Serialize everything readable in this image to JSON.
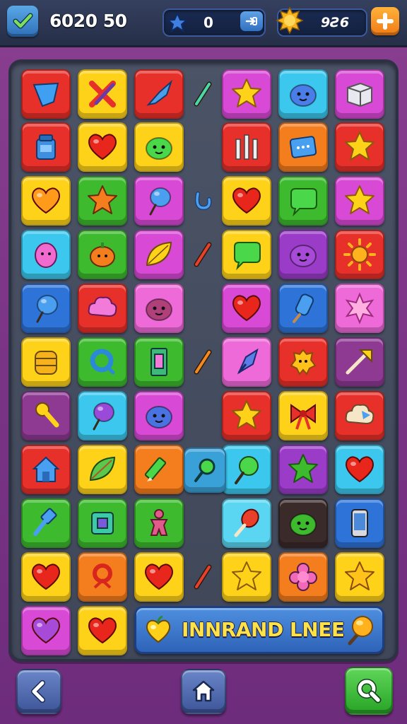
{
  "header": {
    "score": "6020 50",
    "stars_value": "0",
    "coins_value": "9Ƨ6"
  },
  "banner": {
    "text": "INNRAND LNEE"
  },
  "colors": {
    "red": "#e8302a",
    "yellow": "#ffd21a",
    "magenta": "#d84ad6",
    "cyan": "#3cc8ee",
    "orange": "#f47d1e",
    "green": "#3dba2e",
    "blue": "#2d73d8",
    "purple": "#9a3cc8",
    "pink": "#ee6ad8",
    "dark": "#3b2a2a",
    "plum": "#8e3a92",
    "lightcyan": "#5ad6f2"
  },
  "tiles": [
    {
      "r": 0,
      "c": 0,
      "color": "red",
      "icon": "blue-shield"
    },
    {
      "r": 0,
      "c": 1,
      "color": "yellow",
      "icon": "red-cross-pencil"
    },
    {
      "r": 0,
      "c": 2,
      "color": "red",
      "icon": "blue-rocket"
    },
    {
      "r": 0,
      "c": 3,
      "color": "magenta",
      "icon": "star"
    },
    {
      "r": 0,
      "c": 4,
      "color": "cyan",
      "icon": "blue-blob"
    },
    {
      "r": 0,
      "c": 5,
      "color": "magenta",
      "icon": "white-box"
    },
    {
      "r": 1,
      "c": 0,
      "color": "red",
      "icon": "blue-jar"
    },
    {
      "r": 1,
      "c": 1,
      "color": "yellow",
      "icon": "heart"
    },
    {
      "r": 1,
      "c": 2,
      "color": "yellow",
      "icon": "green-blob"
    },
    {
      "r": 1,
      "c": 3,
      "color": "red",
      "icon": "white-bars"
    },
    {
      "r": 1,
      "c": 4,
      "color": "orange",
      "icon": "blue-card"
    },
    {
      "r": 1,
      "c": 5,
      "color": "red",
      "icon": "star"
    },
    {
      "r": 2,
      "c": 0,
      "color": "yellow",
      "icon": "orange-heart"
    },
    {
      "r": 2,
      "c": 1,
      "color": "green",
      "icon": "orange-star"
    },
    {
      "r": 2,
      "c": 2,
      "color": "magenta",
      "icon": "blue-balloon"
    },
    {
      "r": 2,
      "c": 3,
      "color": "yellow",
      "icon": "heart"
    },
    {
      "r": 2,
      "c": 4,
      "color": "green",
      "icon": "green-bubble"
    },
    {
      "r": 2,
      "c": 5,
      "color": "magenta",
      "icon": "star"
    },
    {
      "r": 3,
      "c": 0,
      "color": "cyan",
      "icon": "pink-egg"
    },
    {
      "r": 3,
      "c": 1,
      "color": "green",
      "icon": "orange-pumpkin"
    },
    {
      "r": 3,
      "c": 2,
      "color": "magenta",
      "icon": "yellow-leaf"
    },
    {
      "r": 3,
      "c": 3,
      "color": "yellow",
      "icon": "green-bubble"
    },
    {
      "r": 3,
      "c": 4,
      "color": "purple",
      "icon": "purple-blob"
    },
    {
      "r": 3,
      "c": 5,
      "color": "red",
      "icon": "sun"
    },
    {
      "r": 4,
      "c": 0,
      "color": "blue",
      "icon": "blue-balloon"
    },
    {
      "r": 4,
      "c": 1,
      "color": "red",
      "icon": "pink-cloud"
    },
    {
      "r": 4,
      "c": 2,
      "color": "pink",
      "icon": "plum-blob"
    },
    {
      "r": 4,
      "c": 3,
      "color": "magenta",
      "icon": "heart"
    },
    {
      "r": 4,
      "c": 4,
      "color": "blue",
      "icon": "blue-popsicle"
    },
    {
      "r": 4,
      "c": 5,
      "color": "pink",
      "icon": "pink-burst"
    },
    {
      "r": 5,
      "c": 0,
      "color": "yellow",
      "icon": "yellow-pot"
    },
    {
      "r": 5,
      "c": 1,
      "color": "green",
      "icon": "blue-ring"
    },
    {
      "r": 5,
      "c": 2,
      "color": "green",
      "icon": "blue-door"
    },
    {
      "r": 5,
      "c": 3,
      "color": "pink",
      "icon": "blue-crystal"
    },
    {
      "r": 5,
      "c": 4,
      "color": "red",
      "icon": "yellow-monster"
    },
    {
      "r": 5,
      "c": 5,
      "color": "plum",
      "icon": "arrow"
    },
    {
      "r": 6,
      "c": 0,
      "color": "plum",
      "icon": "yellow-key"
    },
    {
      "r": 6,
      "c": 1,
      "color": "cyan",
      "icon": "purple-balloon"
    },
    {
      "r": 6,
      "c": 2,
      "color": "magenta",
      "icon": "blue-cat"
    },
    {
      "r": 6,
      "c": 3,
      "color": "red",
      "icon": "star"
    },
    {
      "r": 6,
      "c": 4,
      "color": "yellow",
      "icon": "red-bow"
    },
    {
      "r": 6,
      "c": 5,
      "color": "red",
      "icon": "cream-cloud"
    },
    {
      "r": 7,
      "c": 0,
      "color": "red",
      "icon": "blue-house"
    },
    {
      "r": 7,
      "c": 1,
      "color": "yellow",
      "icon": "green-leaf"
    },
    {
      "r": 7,
      "c": 2,
      "color": "orange",
      "icon": "green-pencil"
    },
    {
      "r": 7,
      "c": 3,
      "color": "cyan",
      "icon": "green-lollipop"
    },
    {
      "r": 7,
      "c": 4,
      "color": "purple",
      "icon": "green-star"
    },
    {
      "r": 7,
      "c": 5,
      "color": "cyan",
      "icon": "heart"
    },
    {
      "r": 8,
      "c": 0,
      "color": "green",
      "icon": "blue-hammer"
    },
    {
      "r": 8,
      "c": 1,
      "color": "green",
      "icon": "blue-square"
    },
    {
      "r": 8,
      "c": 2,
      "color": "green",
      "icon": "pink-gingerbread"
    },
    {
      "r": 8,
      "c": 3,
      "color": "lightcyan",
      "icon": "red-drumstick"
    },
    {
      "r": 8,
      "c": 4,
      "color": "dark",
      "icon": "green-smiley"
    },
    {
      "r": 8,
      "c": 5,
      "color": "blue",
      "icon": "phone"
    },
    {
      "r": 9,
      "c": 0,
      "color": "yellow",
      "icon": "heart"
    },
    {
      "r": 9,
      "c": 1,
      "color": "orange",
      "icon": "red-ring"
    },
    {
      "r": 9,
      "c": 2,
      "color": "yellow",
      "icon": "heart"
    },
    {
      "r": 9,
      "c": 3,
      "color": "yellow",
      "icon": "star"
    },
    {
      "r": 9,
      "c": 4,
      "color": "orange",
      "icon": "pink-flower"
    },
    {
      "r": 9,
      "c": 5,
      "color": "yellow",
      "icon": "star-face"
    },
    {
      "r": 10,
      "c": 0,
      "color": "magenta",
      "icon": "purple-heart"
    },
    {
      "r": 10,
      "c": 1,
      "color": "yellow",
      "icon": "heart"
    }
  ],
  "loose_items": [
    {
      "row": 0,
      "icon": "green-stick"
    },
    {
      "row": 2,
      "icon": "blue-hook"
    },
    {
      "row": 3,
      "icon": "red-stick"
    },
    {
      "row": 5,
      "icon": "orange-stick"
    },
    {
      "row": 7,
      "icon": "blue-magnifier-tile"
    },
    {
      "row": 9,
      "icon": "red-stick"
    }
  ]
}
